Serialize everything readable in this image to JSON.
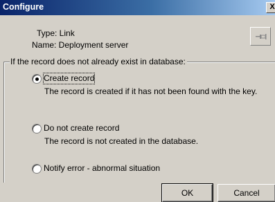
{
  "window": {
    "title": "Configure",
    "close_label": "X"
  },
  "info": {
    "type_text": "Type: Link",
    "name_text": "Name: Deployment server"
  },
  "group": {
    "legend": "If the record does not already exist in database:",
    "options": [
      {
        "label": "Create record",
        "description": "The record is created if it has not been found with the key.",
        "selected": true
      },
      {
        "label": "Do not create record",
        "description": "The record is not created in the database.",
        "selected": false
      },
      {
        "label": "Notify error - abnormal situation",
        "description": "",
        "selected": false
      }
    ]
  },
  "buttons": {
    "ok": "OK",
    "cancel": "Cancel"
  },
  "icons": {
    "pin": "pin-icon",
    "close": "close-icon"
  },
  "colors": {
    "title_start": "#0a246a",
    "title_end": "#a6caf0",
    "face": "#d4d0c8"
  }
}
